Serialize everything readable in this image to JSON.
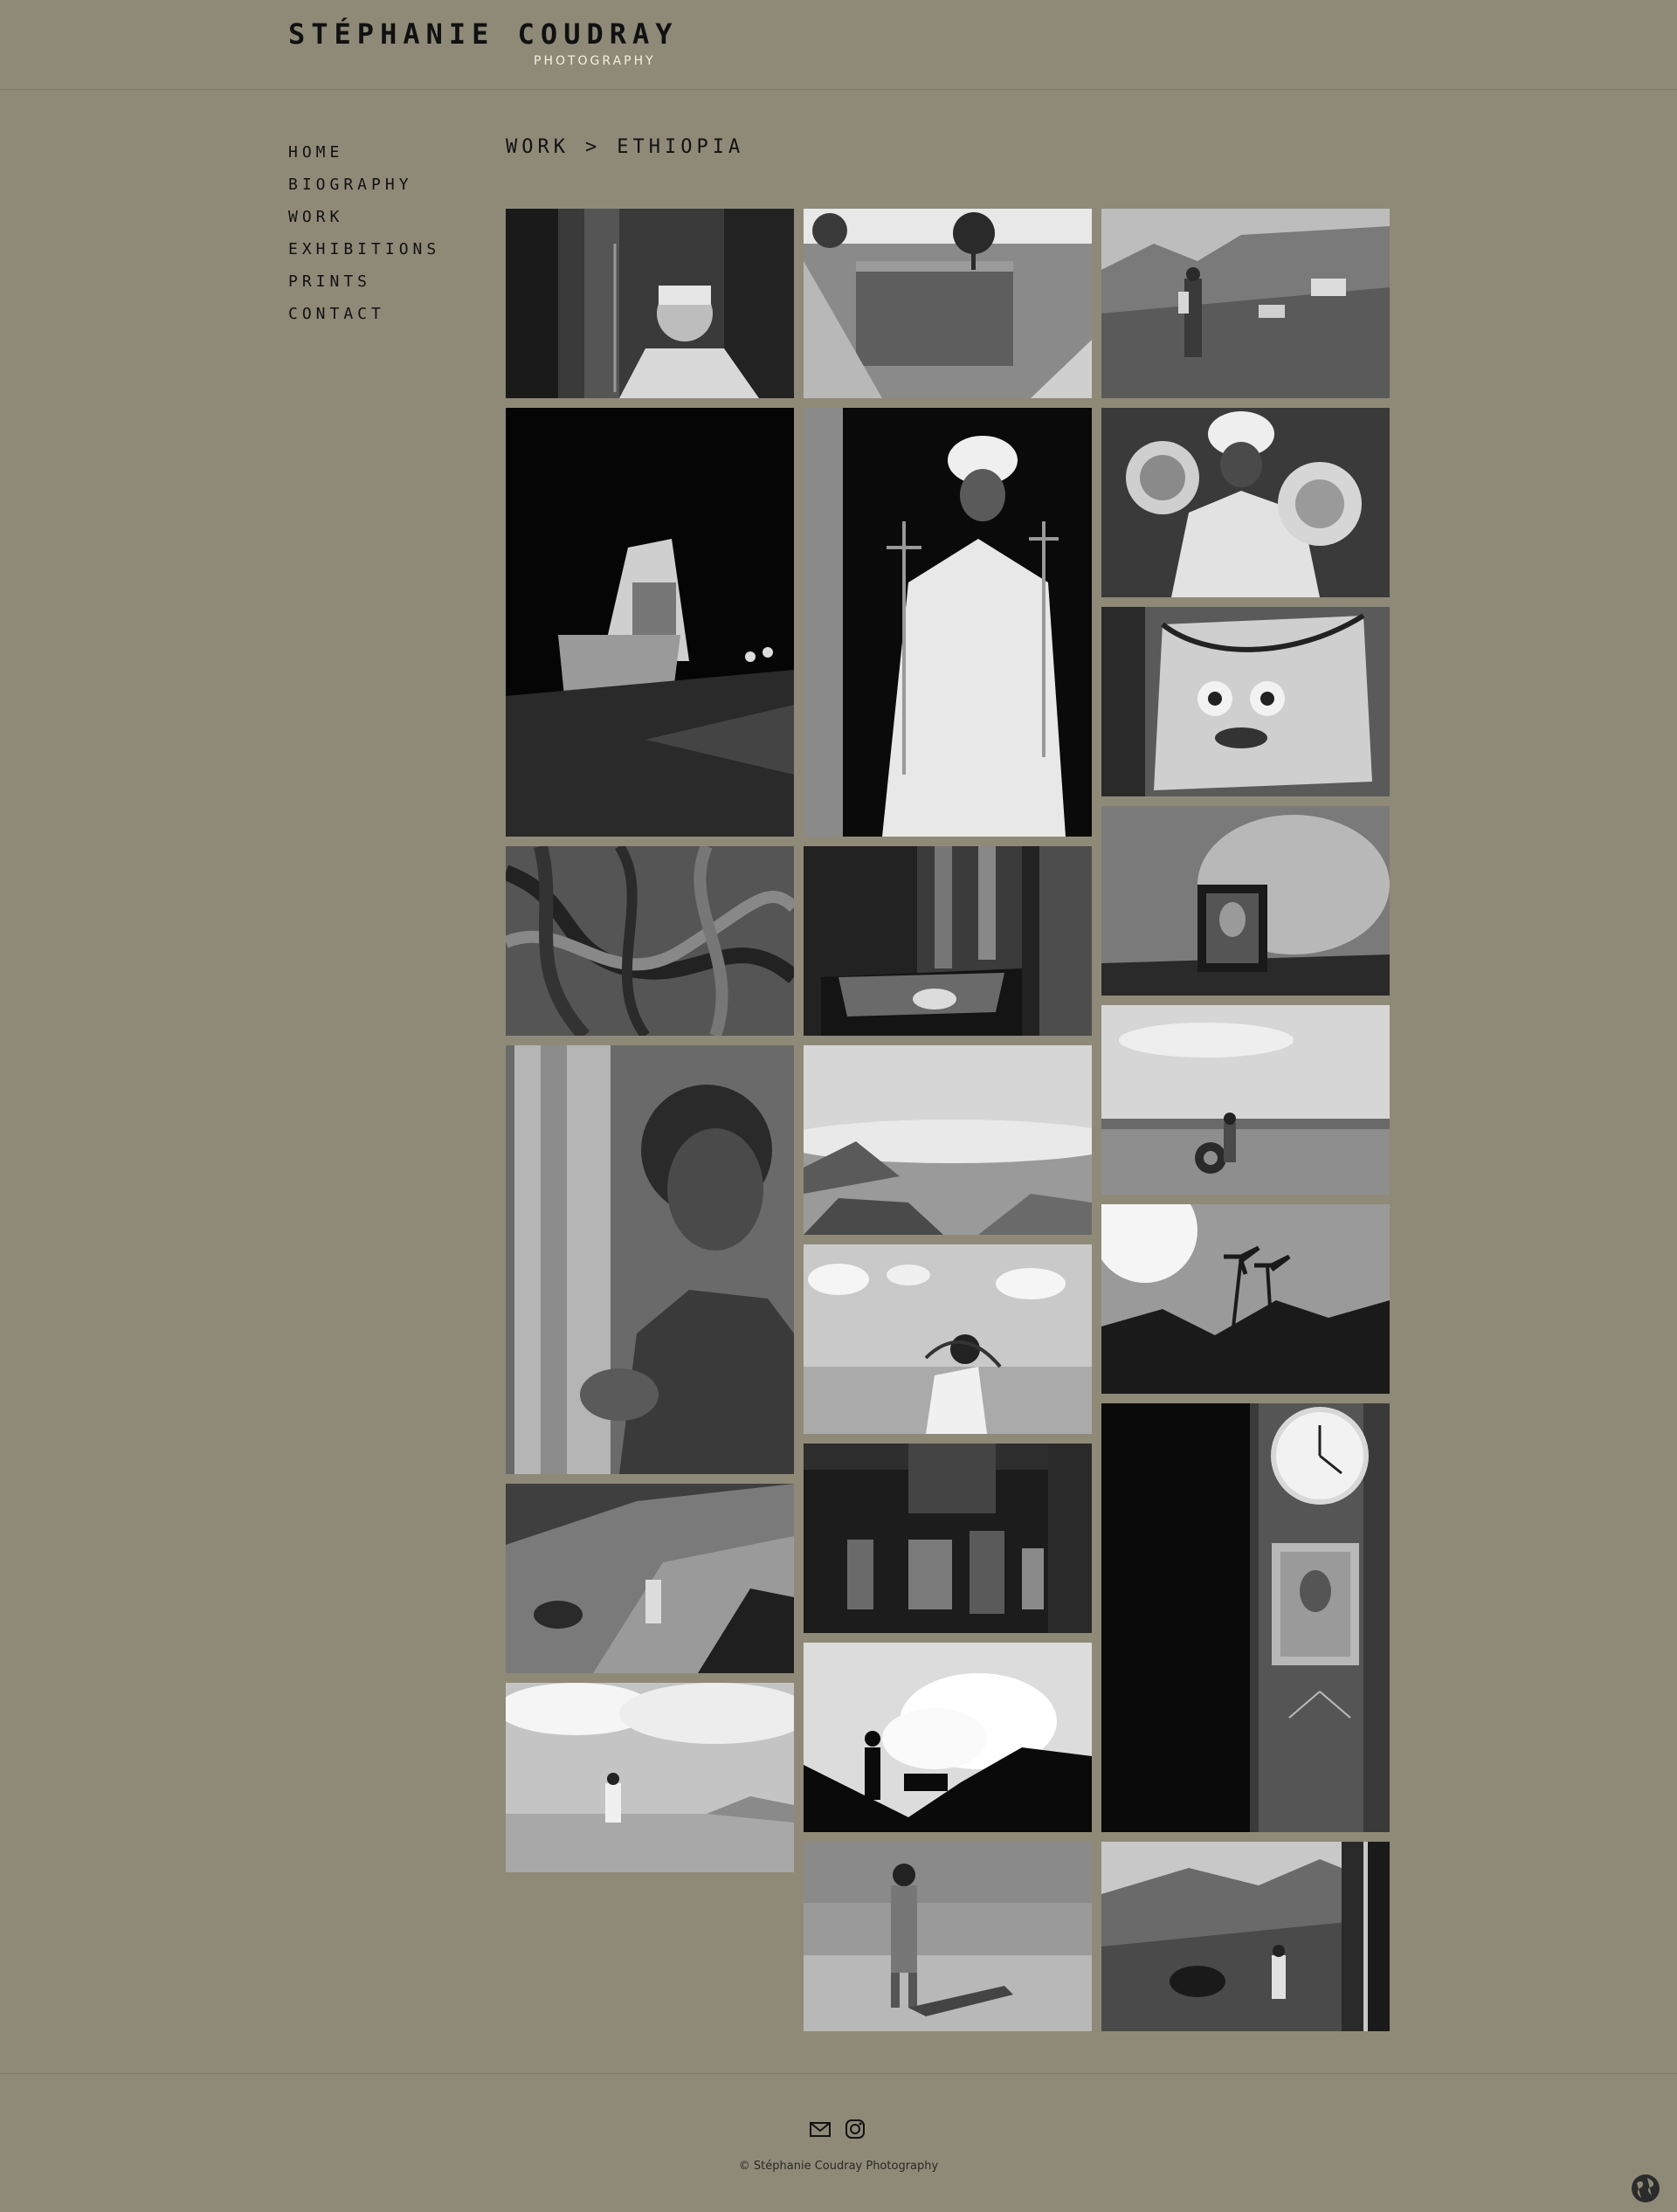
{
  "site": {
    "name": "STÉPHANIE COUDRAY",
    "tagline": "PHOTOGRAPHY"
  },
  "nav": {
    "items": [
      {
        "label": "HOME"
      },
      {
        "label": "BIOGRAPHY"
      },
      {
        "label": "WORK"
      },
      {
        "label": "EXHIBITIONS"
      },
      {
        "label": "PRINTS"
      },
      {
        "label": "CONTACT"
      }
    ]
  },
  "breadcrumb": {
    "parent": "WORK",
    "separator": ">",
    "current": "ETHIOPIA"
  },
  "gallery": {
    "photos": [
      {
        "subject": "priest-portrait-turban"
      },
      {
        "subject": "rock-hewn-church-st-george"
      },
      {
        "subject": "man-walking-hillside"
      },
      {
        "subject": "church-altar-icon"
      },
      {
        "subject": "priest-holding-crosses"
      },
      {
        "subject": "priest-with-processional-crosses"
      },
      {
        "subject": "painted-wall-face"
      },
      {
        "subject": "tree-roots"
      },
      {
        "subject": "church-interior-table"
      },
      {
        "subject": "jesus-icon-on-wall"
      },
      {
        "subject": "girl-portrait"
      },
      {
        "subject": "volcanic-landscape-steam"
      },
      {
        "subject": "boy-rolling-tire"
      },
      {
        "subject": "palm-trees-sunburst"
      },
      {
        "subject": "man-carrying-load-desert"
      },
      {
        "subject": "church-interior-paintings"
      },
      {
        "subject": "clock-and-jesus-portrait"
      },
      {
        "subject": "people-on-rocky-hill"
      },
      {
        "subject": "silhouettes-donkey-cloud"
      },
      {
        "subject": "person-under-clouds"
      },
      {
        "subject": "child-standing-field"
      },
      {
        "subject": "man-with-donkey-mountains"
      }
    ]
  },
  "footer": {
    "email_icon": "envelope-icon",
    "instagram_icon": "instagram-icon",
    "copyright": "© Stéphanie Coudray Photography",
    "language_icon": "globe-icon"
  },
  "colors": {
    "background": "#8f8a78",
    "text": "#111111",
    "tagline": "#f2efe6"
  }
}
